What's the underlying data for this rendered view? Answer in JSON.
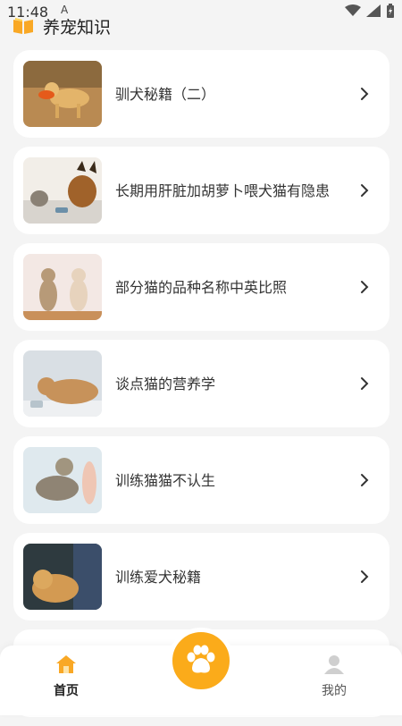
{
  "status_bar": {
    "time": "11:48",
    "indicator": "A"
  },
  "header": {
    "title": "养宠知识"
  },
  "articles": [
    {
      "title": "驯犬秘籍（二）"
    },
    {
      "title": "长期用肝脏加胡萝卜喂犬猫有隐患"
    },
    {
      "title": "部分猫的品种名称中英比照"
    },
    {
      "title": "谈点猫的营养学"
    },
    {
      "title": "训练猫猫不认生"
    },
    {
      "title": "训练爱犬秘籍"
    }
  ],
  "tabbar": {
    "home_label": "首页",
    "mine_label": "我的",
    "active": "home",
    "accent_color": "#fbab1a"
  },
  "icons": [
    "book-icon",
    "chevron-right-icon",
    "home-icon",
    "paw-icon",
    "user-icon",
    "wifi-icon",
    "signal-icon",
    "battery-icon"
  ]
}
